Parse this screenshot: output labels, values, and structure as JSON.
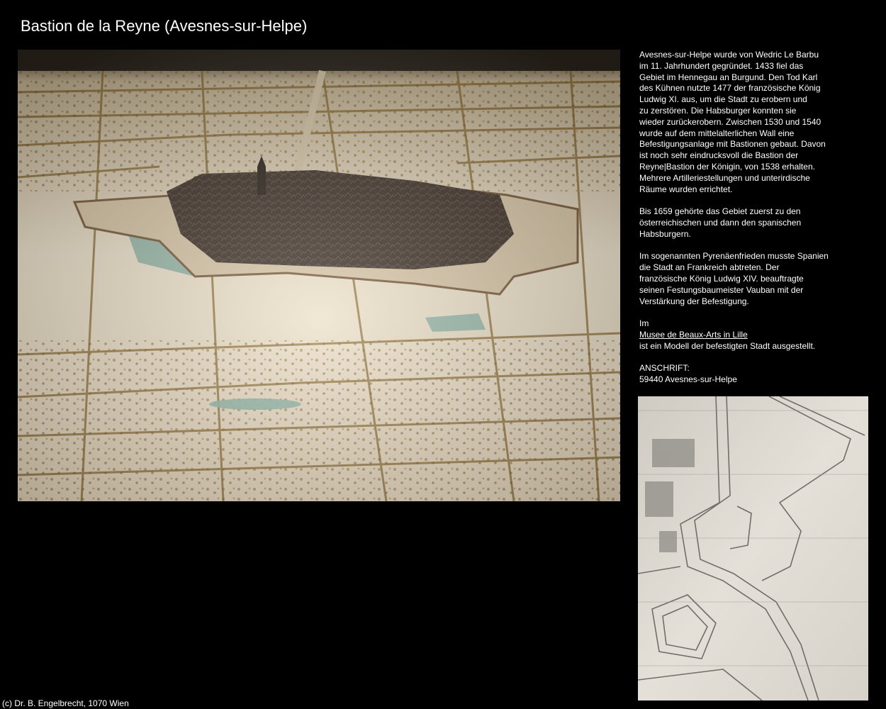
{
  "page": {
    "title": "Bastion de la Reyne (Avesnes-sur-Helpe)",
    "footer": "(c) Dr. B. Engelbrecht, 1070 Wien"
  },
  "description": {
    "paragraph1": [
      "Avesnes-sur-Helpe wurde von Wedric Le Barbu",
      "im 11. Jahrhundert gegründet. 1433 fiel das",
      "Gebiet im Hennegau an Burgund. Den Tod Karl",
      "des Kühnen nutzte 1477 der französische König",
      "Ludwig XI. aus, um die Stadt zu erobern und",
      "zu zerstören. Die Habsburger konnten sie",
      "wieder zurückerobern. Zwischen 1530 und 1540",
      "wurde auf dem mittelalterlichen Wall eine",
      "Befestigungsanlage mit Bastionen gebaut. Davon",
      "ist noch sehr eindrucksvoll die Bastion der",
      "Reyne|Bastion der Königin, von 1538 erhalten.",
      "Mehrere Artilleriestellungen und unterirdische",
      "Räume wurden errichtet."
    ],
    "paragraph2": [
      "Bis 1659 gehörte das Gebiet zuerst zu den",
      "österreichischen und dann den spanischen",
      "Habsburgern."
    ],
    "paragraph3": [
      "Im sogenannten Pyrenäenfrieden musste Spanien",
      "die Stadt an Frankreich abtreten. Der",
      "französische König Ludwig XIV. beauftragte",
      "seinen Festungsbaumeister Vauban mit der",
      "Verstärkung der Befestigung."
    ],
    "museum": {
      "prefix": "Im",
      "link_text": "Musee de Beaux-Arts in Lille",
      "suffix": "ist ein Modell der befestigten Stadt ausgestellt."
    },
    "address": {
      "label": "ANSCHRIFT:",
      "value": "59440 Avesnes-sur-Helpe"
    }
  },
  "colors": {
    "background": "#000000",
    "text": "#ffffff",
    "model_base": "#efe3cc",
    "model_town": "#3a2e24",
    "moat_water": "#8fb3a3",
    "plan_paper": "#e4e0d8",
    "plan_ink": "#6f6e6a"
  }
}
